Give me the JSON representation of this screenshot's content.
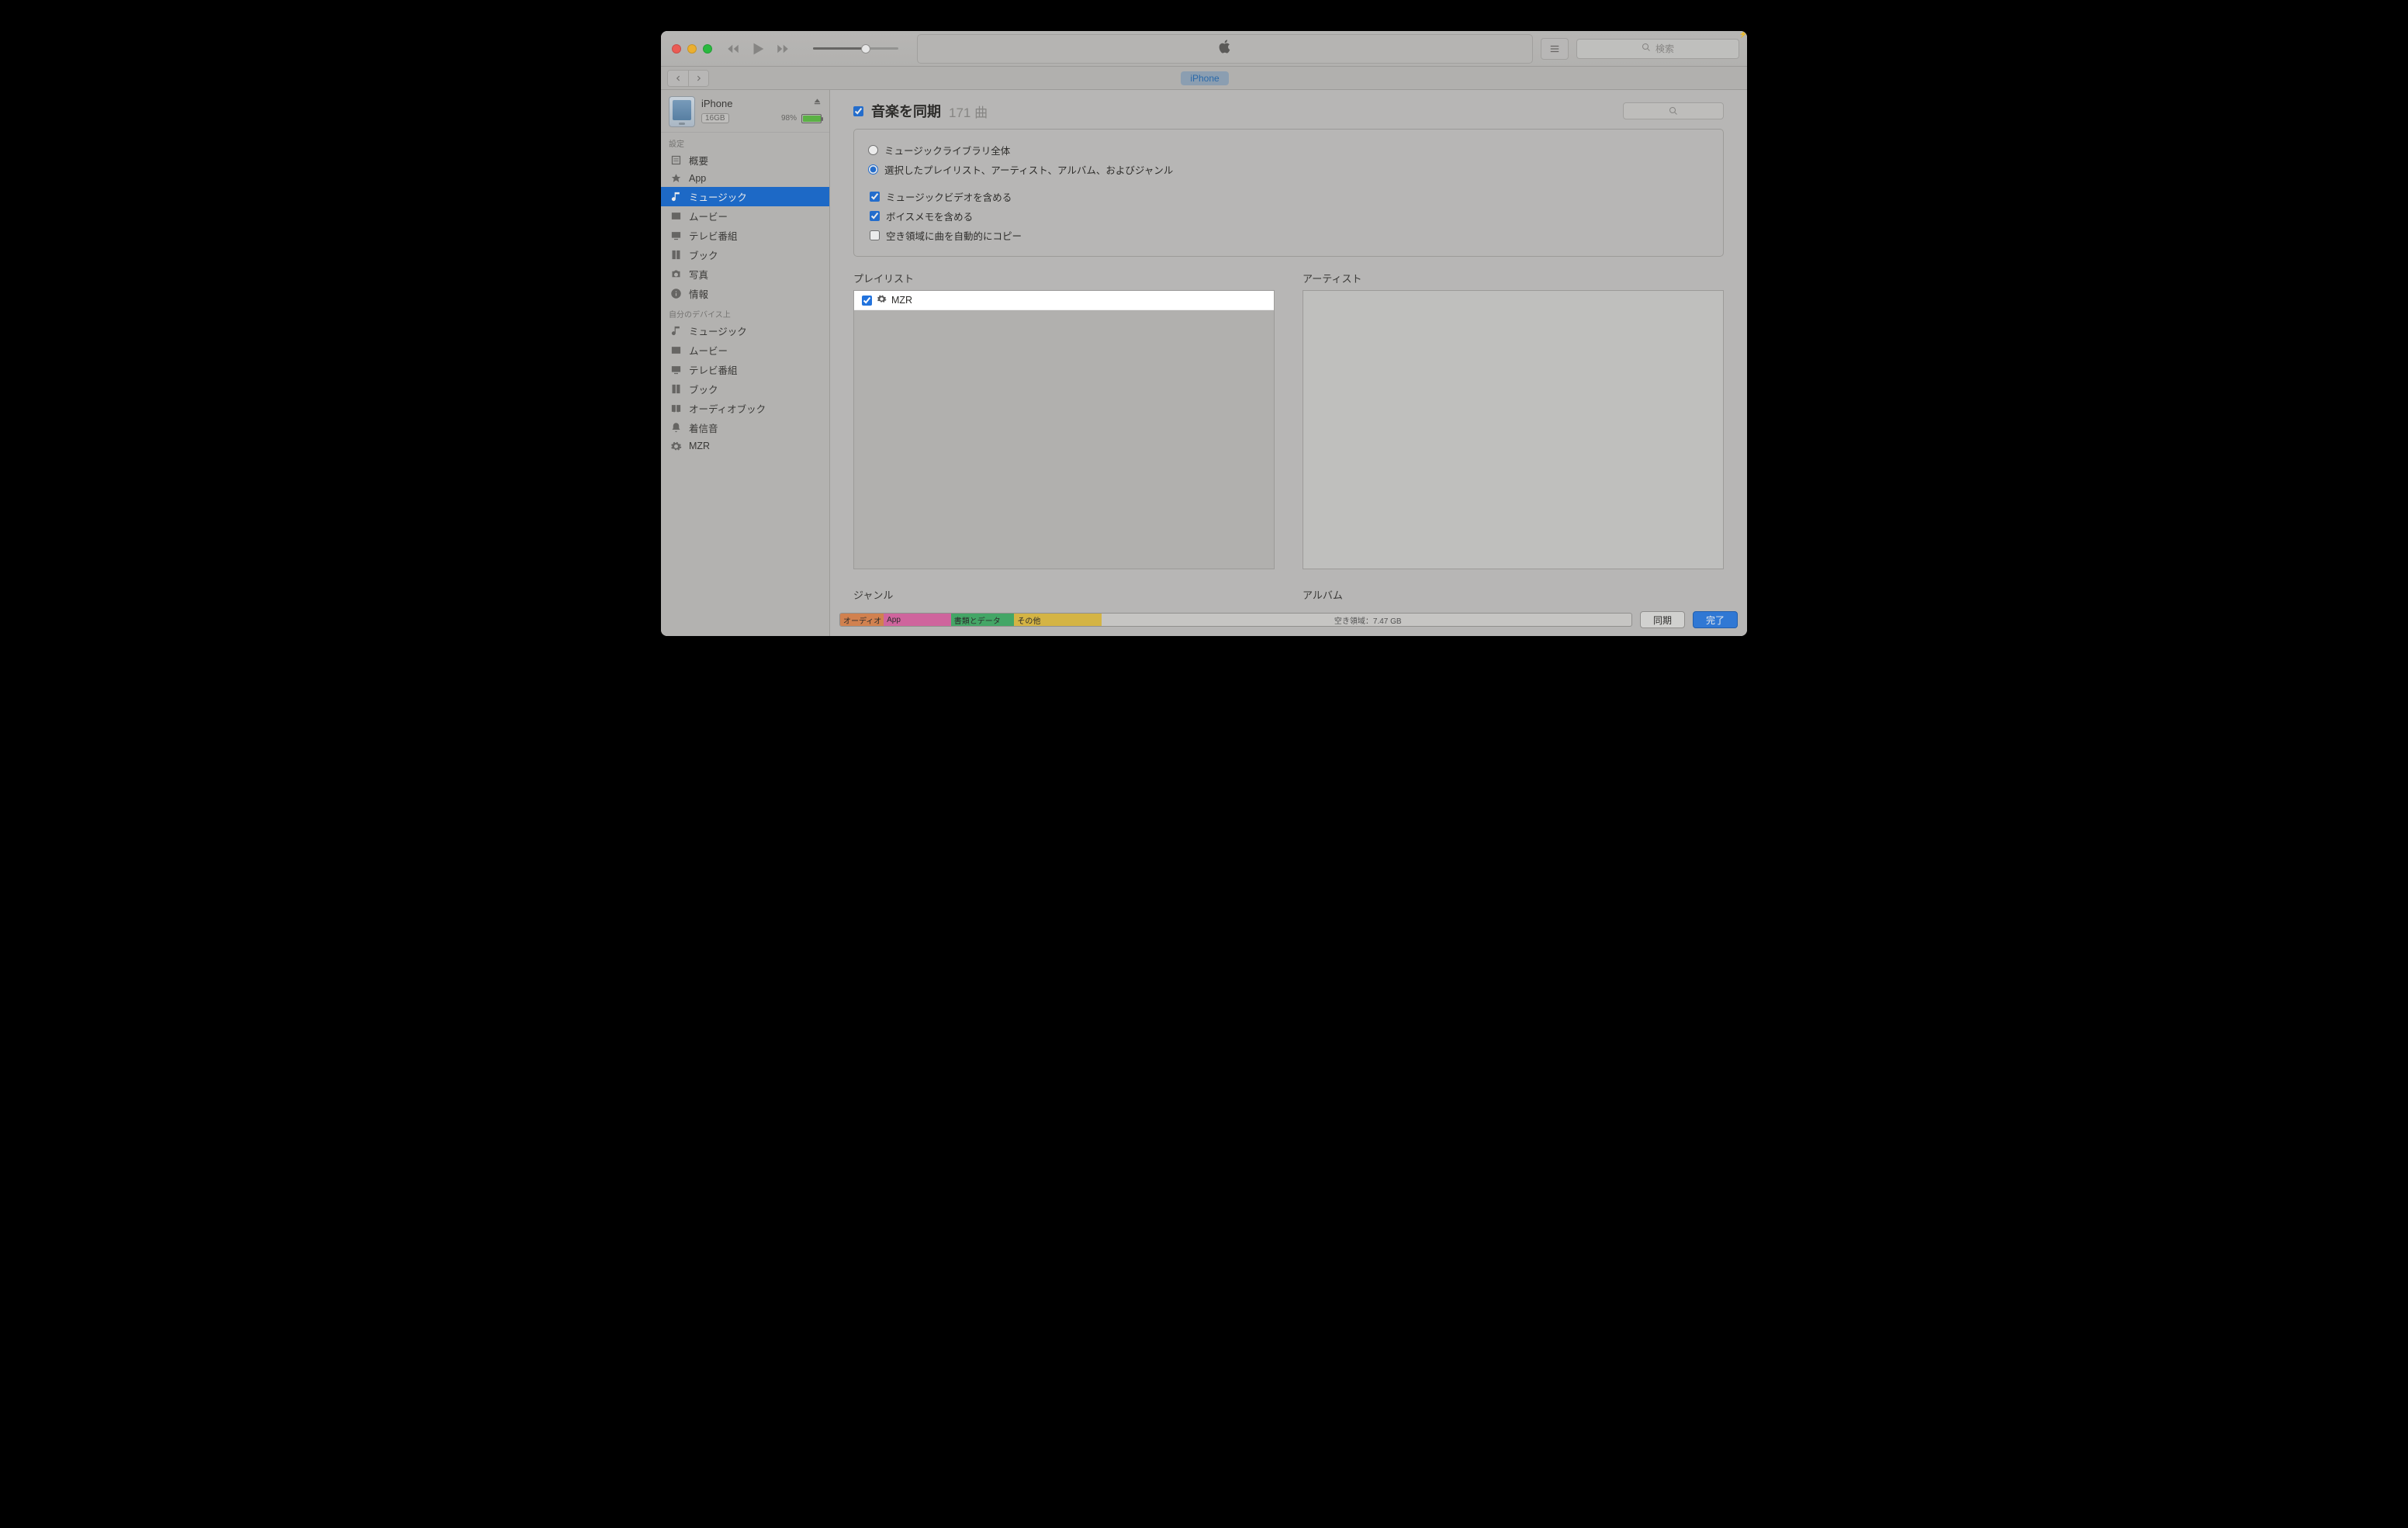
{
  "toolbar": {
    "search_placeholder": "検索",
    "location": "iPhone"
  },
  "device": {
    "name": "iPhone",
    "capacity_label": "16GB",
    "battery_pct": "98%",
    "battery_fill_pct": 98
  },
  "sidebar": {
    "section_settings_label": "設定",
    "settings": [
      {
        "icon": "summary",
        "label": "概要"
      },
      {
        "icon": "app",
        "label": "App"
      },
      {
        "icon": "music",
        "label": "ミュージック",
        "selected": true
      },
      {
        "icon": "movie",
        "label": "ムービー"
      },
      {
        "icon": "tv",
        "label": "テレビ番組"
      },
      {
        "icon": "book",
        "label": "ブック"
      },
      {
        "icon": "photo",
        "label": "写真"
      },
      {
        "icon": "info",
        "label": "情報"
      }
    ],
    "section_ondevice_label": "自分のデバイス上",
    "ondevice": [
      {
        "icon": "music",
        "label": "ミュージック"
      },
      {
        "icon": "movie",
        "label": "ムービー"
      },
      {
        "icon": "tv",
        "label": "テレビ番組"
      },
      {
        "icon": "book",
        "label": "ブック"
      },
      {
        "icon": "audiobook",
        "label": "オーディオブック"
      },
      {
        "icon": "ringtone",
        "label": "着信音"
      },
      {
        "icon": "gear",
        "label": "MZR"
      }
    ]
  },
  "main": {
    "sync_enabled": true,
    "sync_label": "音楽を同期",
    "count_text": "171 曲",
    "options": {
      "radio_all_label": "ミュージックライブラリ全体",
      "radio_selected_label": "選択したプレイリスト、アーティスト、アルバム、およびジャンル",
      "radio_value": "selected",
      "include_mv_label": "ミュージックビデオを含める",
      "include_mv": true,
      "include_vm_label": "ボイスメモを含める",
      "include_vm": true,
      "autofill_label": "空き領域に曲を自動的にコピー",
      "autofill": false
    },
    "cols": {
      "playlist_label": "プレイリスト",
      "artist_label": "アーティスト",
      "genre_label": "ジャンル",
      "album_label": "アルバム"
    },
    "playlists": [
      {
        "name": "MZR",
        "checked": true
      }
    ]
  },
  "storage": {
    "segments": [
      {
        "kind": "audio",
        "label": "オーディオ",
        "width_pct": 5.5
      },
      {
        "kind": "app",
        "label": "App",
        "width_pct": 8.5
      },
      {
        "kind": "docs",
        "label": "書類とデータ",
        "width_pct": 8
      },
      {
        "kind": "other",
        "label": "その他",
        "width_pct": 11
      },
      {
        "kind": "free",
        "label": "空き領域：7.47 GB",
        "width_pct": 67
      }
    ]
  },
  "buttons": {
    "sync": "同期",
    "done": "完了"
  }
}
